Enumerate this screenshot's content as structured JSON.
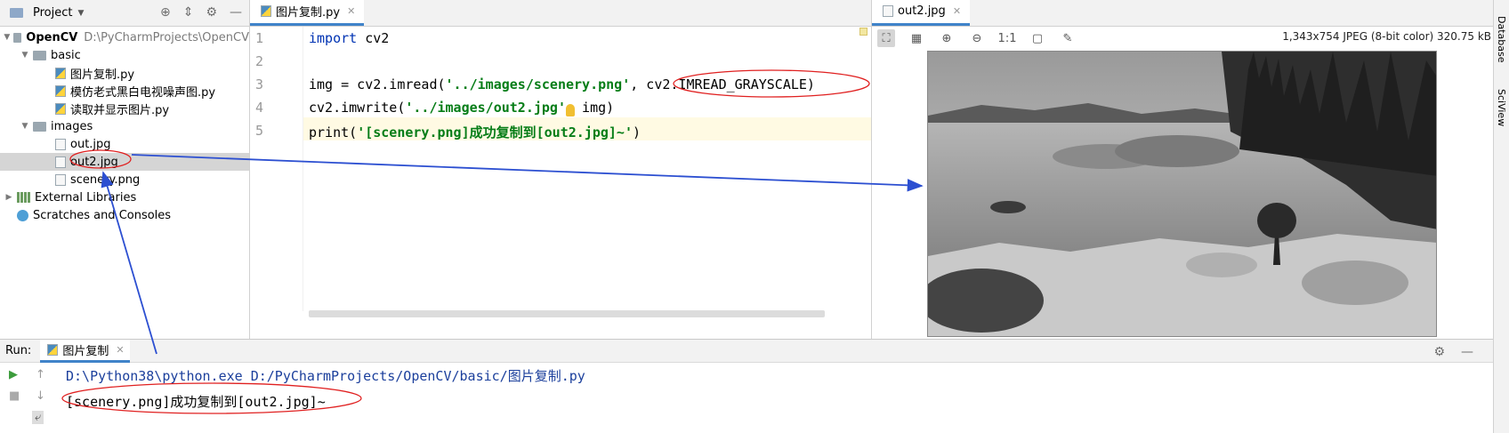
{
  "project_panel": {
    "title": "Project",
    "tree": [
      {
        "label": "OpenCV",
        "path": "D:\\PyCharmProjects\\OpenCV"
      },
      {
        "label": "basic"
      },
      {
        "label": "图片复制.py"
      },
      {
        "label": "模仿老式黑白电视噪声图.py"
      },
      {
        "label": "读取并显示图片.py"
      },
      {
        "label": "images"
      },
      {
        "label": "out.jpg"
      },
      {
        "label": "out2.jpg"
      },
      {
        "label": "scenery.png"
      },
      {
        "label": "External Libraries"
      },
      {
        "label": "Scratches and Consoles"
      }
    ]
  },
  "editor": {
    "tab_label": "图片复制.py",
    "line_numbers": [
      "1",
      "2",
      "3",
      "4",
      "5"
    ],
    "lines": {
      "l1_kw": "import",
      "l1_rest": " cv2",
      "l3_a": "img = cv2.imread(",
      "l3_str": "'../images/scenery.png'",
      "l3_b": ", cv2.IMREAD_GRAYSCALE)",
      "l4_a": "cv2.imwrite(",
      "l4_str": "'../images/out2.jpg'",
      "l4_b": ", img)",
      "l5_a": "print(",
      "l5_str": "'[scenery.png]成功复制到[out2.jpg]~'",
      "l5_b": ")"
    }
  },
  "viewer": {
    "tab_label": "out2.jpg",
    "zoom_label": "1:1",
    "info": "1,343x754 JPEG (8-bit color) 320.75 kB"
  },
  "right_stripe": {
    "database": "Database",
    "sciview": "SciView"
  },
  "run": {
    "label": "Run:",
    "tab_label": "图片复制",
    "command": "D:\\Python38\\python.exe D:/PyCharmProjects/OpenCV/basic/图片复制.py",
    "output": "[scenery.png]成功复制到[out2.jpg]~"
  },
  "colors": {
    "accent": "#4083c9",
    "annotation_red": "#e02020",
    "annotation_blue": "#2c4fd1"
  }
}
